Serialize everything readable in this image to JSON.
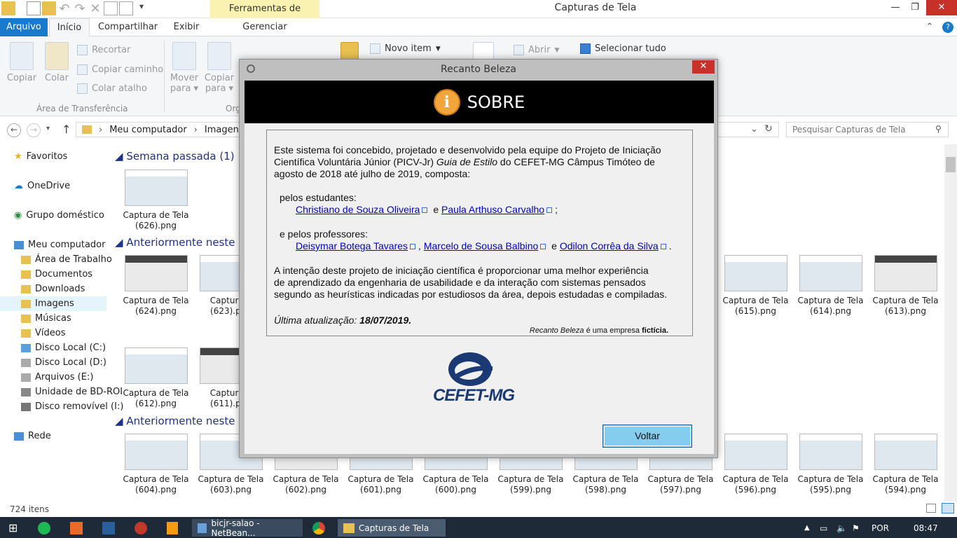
{
  "window": {
    "title": "Capturas de Tela",
    "context_tab": "Ferramentas de Imagem",
    "context_subtab": "Gerenciar"
  },
  "ribbon_tabs": [
    "Arquivo",
    "Início",
    "Compartilhar",
    "Exibir"
  ],
  "ribbon": {
    "copiar": "Copiar",
    "colar": "Colar",
    "recortar": "Recortar",
    "copiar_caminho": "Copiar caminho",
    "colar_atalho": "Colar atalho",
    "group_clipboard": "Área de Transferência",
    "mover_para_1": "Mover",
    "mover_para_2": "para",
    "copiar_para_1": "Copiar",
    "copiar_para_2": "para",
    "group_org": "Org",
    "novo_item": "Novo item",
    "abrir": "Abrir",
    "selecionar_tudo": "Selecionar tudo"
  },
  "address": {
    "crumbs": [
      "Meu computador",
      "Imagens"
    ],
    "search_placeholder": "Pesquisar Capturas de Tela"
  },
  "nav": {
    "favoritos": "Favoritos",
    "onedrive": "OneDrive",
    "grupo": "Grupo doméstico",
    "computador": "Meu computador",
    "items": [
      "Área de Trabalho",
      "Documentos",
      "Downloads",
      "Imagens",
      "Músicas",
      "Vídeos",
      "Disco Local (C:)",
      "Disco Local (D:)",
      "Arquivos (E:)",
      "Unidade de BD-ROI",
      "Disco removível (I:)"
    ],
    "rede": "Rede"
  },
  "sections": {
    "s1": "Semana passada (1)",
    "s2": "Anteriormente neste mês",
    "s3": "Anteriormente neste ano"
  },
  "files": {
    "row1": [
      [
        "Captura de Tela",
        "(626).png"
      ]
    ],
    "row2": [
      [
        "Captura de Tela",
        "(624).png"
      ],
      [
        "Captura d",
        "(623).png"
      ],
      [
        "Captura de Tela",
        "(615).png"
      ],
      [
        "Captura de Tela",
        "(614).png"
      ],
      [
        "Captura de Tela",
        "(613).png"
      ]
    ],
    "row3": [
      [
        "Captura de Tela",
        "(612).png"
      ],
      [
        "Captura d",
        "(611).png"
      ]
    ],
    "row4": [
      [
        "Captura de Tela",
        "(604).png"
      ],
      [
        "Captura de Tela",
        "(603).png"
      ],
      [
        "Captura de Tela",
        "(602).png"
      ],
      [
        "Captura de Tela",
        "(601).png"
      ],
      [
        "Captura de Tela",
        "(600).png"
      ],
      [
        "Captura de Tela",
        "(599).png"
      ],
      [
        "Captura de Tela",
        "(598).png"
      ],
      [
        "Captura de Tela",
        "(597).png"
      ],
      [
        "Captura de Tela",
        "(596).png"
      ],
      [
        "Captura de Tela",
        "(595).png"
      ],
      [
        "Captura de Tela",
        "(594).png"
      ]
    ]
  },
  "status": {
    "count": "724 itens"
  },
  "dialog": {
    "title": "Recanto Beleza",
    "header": "SOBRE",
    "intro_1": "Este sistema foi concebido, projetado e desenvolvido pela equipe do Projeto de Iniciação",
    "intro_2a": "Científica Voluntária Júnior (PICV-Jr) ",
    "intro_2b": "Guia de Estilo",
    "intro_2c": " do CEFET-MG Câmpus Timóteo de",
    "intro_3": "agosto de 2018 até julho de 2019, composta:",
    "estudantes_label": "pelos estudantes:",
    "estudante_1": "Christiano de Souza Oliveira",
    "estudante_2": "Paula Arthuso Carvalho",
    "professores_label": "e pelos professores:",
    "professor_1": "Deisymar Botega Tavares",
    "professor_2": "Marcelo de Sousa Balbino",
    "professor_3": "Odilon Corrêa da Silva",
    "e": "e",
    "comma": ",",
    "semicolon": ";",
    "period": ".",
    "intencao_1": "A intenção deste projeto de iniciação científica é proporcionar uma melhor experiência",
    "intencao_2": "de aprendizado da engenharia de usabilidade e da interação com sistemas pensados",
    "intencao_3": "segundo as heurísticas indicadas por estudiosos da área, depois estudadas e compiladas.",
    "atualizacao_label": "Última atualização: ",
    "atualizacao_data": "18/07/2019.",
    "ficticia_a": "Recanto Beleza",
    "ficticia_b": " é uma empresa ",
    "ficticia_c": "fictícia.",
    "logo_text": "CEFET-MG",
    "voltar": "Voltar"
  },
  "taskbar": {
    "netbeans": "bicjr-salao - NetBean...",
    "explorer": "Capturas de Tela",
    "lang": "POR",
    "time": "08:47"
  }
}
